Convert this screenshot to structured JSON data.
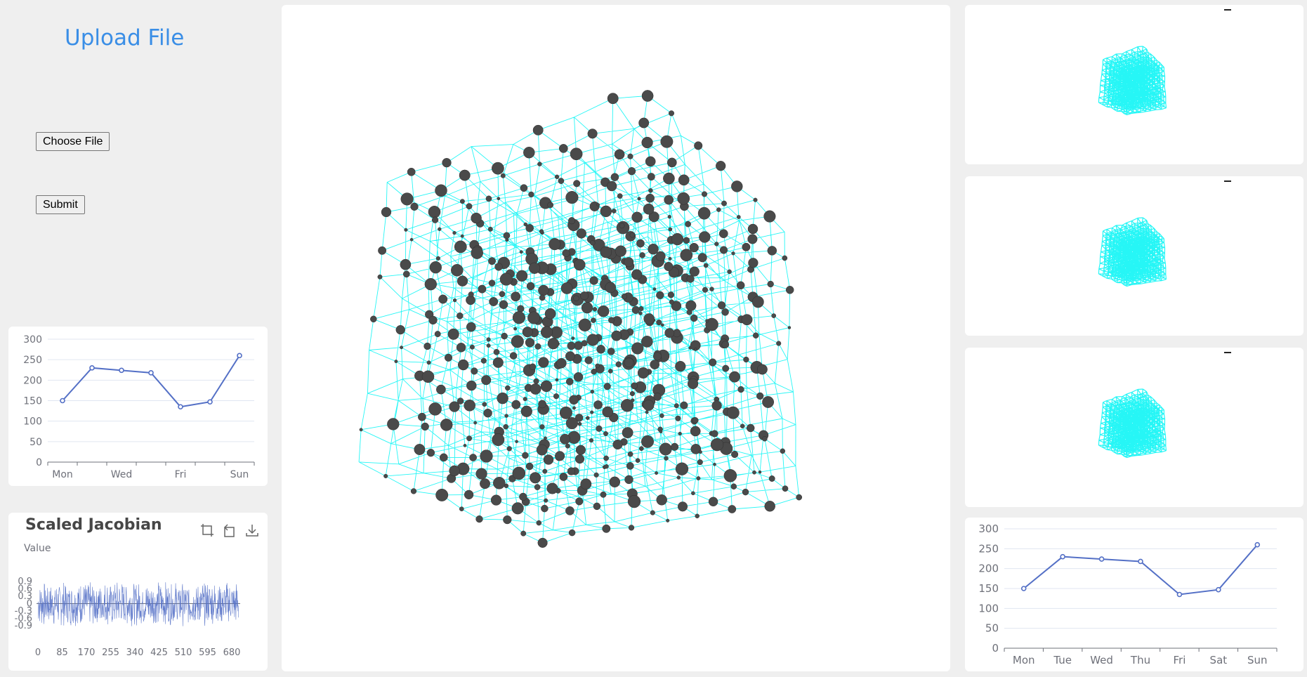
{
  "upload": {
    "title": "Upload File",
    "choose_label": "Choose File",
    "submit_label": "Submit"
  },
  "colors": {
    "accent": "#3a8ee6",
    "series": "#5470c6",
    "mesh": "#00f5f5",
    "node": "#4a4a4a"
  },
  "line_chart_left": {
    "type": "line",
    "categories": [
      "Mon",
      "Tue",
      "Wed",
      "Thu",
      "Fri",
      "Sat",
      "Sun"
    ],
    "shown_tick_labels": [
      "Mon",
      "Wed",
      "Fri",
      "Sun"
    ],
    "values": [
      150,
      230,
      224,
      218,
      135,
      147,
      260
    ],
    "ylim": [
      0,
      300
    ],
    "yticks": [
      0,
      50,
      100,
      150,
      200,
      250,
      300
    ]
  },
  "line_chart_right": {
    "type": "line",
    "categories": [
      "Mon",
      "Tue",
      "Wed",
      "Thu",
      "Fri",
      "Sat",
      "Sun"
    ],
    "shown_tick_labels": [
      "Mon",
      "Tue",
      "Wed",
      "Thu",
      "Fri",
      "Sat",
      "Sun"
    ],
    "values": [
      150,
      230,
      224,
      218,
      135,
      147,
      260
    ],
    "ylim": [
      0,
      300
    ],
    "yticks": [
      0,
      50,
      100,
      150,
      200,
      250,
      300
    ]
  },
  "jacobian": {
    "title": "Scaled Jacobian",
    "yname": "Value",
    "yticks": [
      "0.9",
      "0.6",
      "0.3",
      "0",
      "-0.3",
      "-0.6",
      "-0.9"
    ],
    "xticks": [
      "0",
      "85",
      "170",
      "255",
      "340",
      "425",
      "510",
      "595",
      "680"
    ],
    "toolbox": [
      "zoom-icon",
      "restore-icon",
      "download-icon"
    ]
  },
  "chart_data": [
    {
      "type": "line",
      "categories": [
        "Mon",
        "Tue",
        "Wed",
        "Thu",
        "Fri",
        "Sat",
        "Sun"
      ],
      "values": [
        150,
        230,
        224,
        218,
        135,
        147,
        260
      ],
      "ylim": [
        0,
        300
      ]
    },
    {
      "type": "line",
      "categories": [
        "Mon",
        "Tue",
        "Wed",
        "Thu",
        "Fri",
        "Sat",
        "Sun"
      ],
      "values": [
        150,
        230,
        224,
        218,
        135,
        147,
        260
      ],
      "ylim": [
        0,
        300
      ]
    },
    {
      "type": "line",
      "title": "Scaled Jacobian",
      "ylabel": "Value",
      "x_range": [
        0,
        700
      ],
      "ylim": [
        -1,
        1
      ],
      "note_values": "dense noisy series of ~700 samples between about -0.95 and 0.95"
    }
  ]
}
